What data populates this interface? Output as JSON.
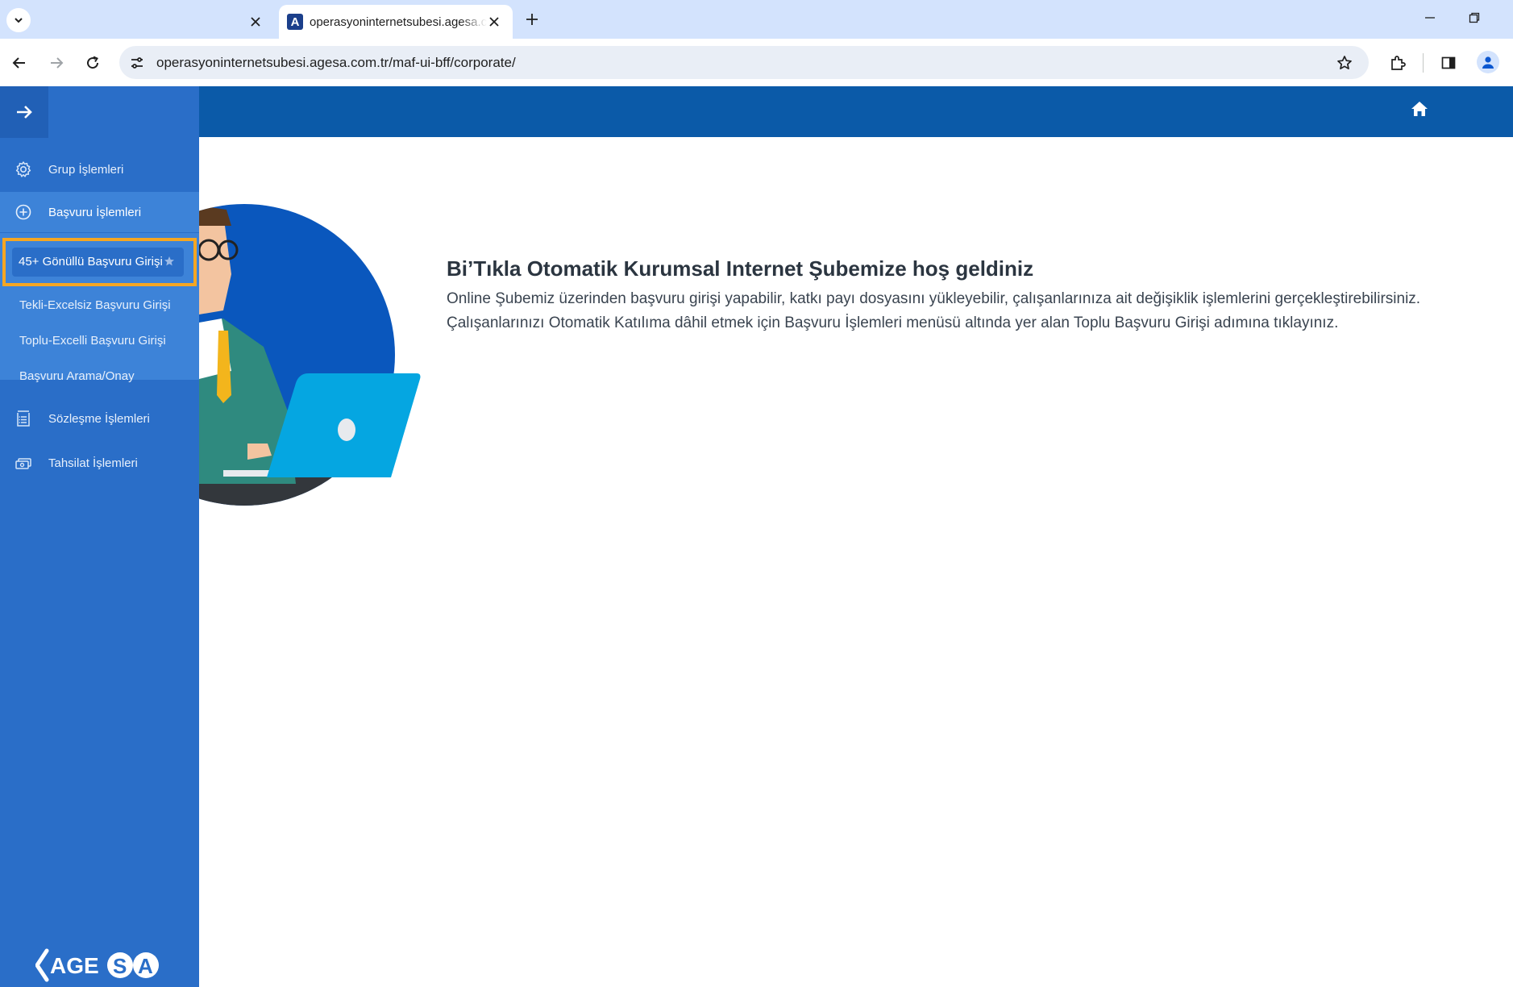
{
  "browser": {
    "inactive_tab_title": "",
    "active_tab_title": "operasyoninternetsubesi.agesa.com.tr",
    "favicon_letter": "A",
    "url": "operasyoninternetsubesi.agesa.com.tr/maf-ui-bff/corporate/"
  },
  "sidebar": {
    "items": [
      {
        "label": "Grup İşlemleri",
        "icon": "gear-icon"
      },
      {
        "label": "Başvuru İşlemleri",
        "icon": "plus-circle-icon"
      },
      {
        "label": "Sözleşme İşlemleri",
        "icon": "document-list-icon"
      },
      {
        "label": "Tahsilat İşlemleri",
        "icon": "money-icon"
      }
    ],
    "submenu": [
      {
        "label": "45+ Gönüllü Başvuru Girişi",
        "active": true
      },
      {
        "label": "Tekli-Excelsiz Başvuru Girişi"
      },
      {
        "label": "Toplu-Excelli Başvuru Girişi"
      },
      {
        "label": "Başvuru Arama/Onay"
      }
    ],
    "logo_text": "AGESA"
  },
  "main": {
    "title": "Bi’Tıkla Otomatik Kurumsal Internet Şubemize hoş geldiniz",
    "paragraph_line1": "Online Şubemiz üzerinden başvuru girişi yapabilir, katkı payı dosyasını yükleyebilir, çalışanlarınıza ait değişiklik işlemlerini gerçekleştirebilirsiniz.",
    "paragraph_line2": "Çalışanlarınızı Otomatik Katılıma dâhil etmek için Başvuru İşlemleri menüsü altında yer alan Toplu Başvuru Girişi adımına tıklayınız."
  },
  "colors": {
    "sidebar": "#2a6ec8",
    "header": "#0b5aa8",
    "highlight": "#f5a623"
  }
}
